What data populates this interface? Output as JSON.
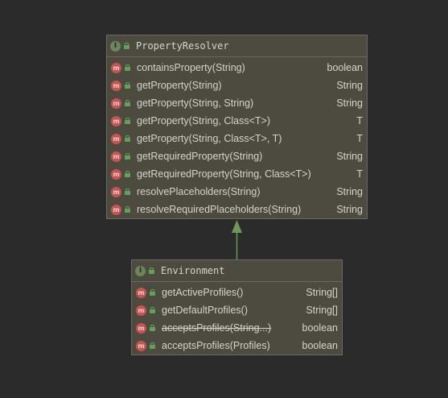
{
  "property_resolver": {
    "title": "PropertyResolver",
    "kind_icon": "interface-icon",
    "kind_letter": "I",
    "methods": [
      {
        "name": "containsProperty(String)",
        "type": "boolean",
        "deprecated": false
      },
      {
        "name": "getProperty(String)",
        "type": "String",
        "deprecated": false
      },
      {
        "name": "getProperty(String, String)",
        "type": "String",
        "deprecated": false
      },
      {
        "name": "getProperty(String, Class<T>)",
        "type": "T",
        "deprecated": false
      },
      {
        "name": "getProperty(String, Class<T>, T)",
        "type": "T",
        "deprecated": false
      },
      {
        "name": "getRequiredProperty(String)",
        "type": "String",
        "deprecated": false
      },
      {
        "name": "getRequiredProperty(String, Class<T>)",
        "type": "T",
        "deprecated": false
      },
      {
        "name": "resolvePlaceholders(String)",
        "type": "String",
        "deprecated": false
      },
      {
        "name": "resolveRequiredPlaceholders(String)",
        "type": "String",
        "deprecated": false
      }
    ]
  },
  "environment": {
    "title": "Environment",
    "kind_icon": "interface-icon",
    "kind_letter": "I",
    "methods": [
      {
        "name": "getActiveProfiles()",
        "type": "String[]",
        "deprecated": false
      },
      {
        "name": "getDefaultProfiles()",
        "type": "String[]",
        "deprecated": false
      },
      {
        "name": "acceptsProfiles(String...)",
        "type": "boolean",
        "deprecated": true
      },
      {
        "name": "acceptsProfiles(Profiles)",
        "type": "boolean",
        "deprecated": false
      }
    ]
  },
  "method_icon_letter": "m",
  "colors": {
    "background": "#2b2b2b",
    "box": "#4d4b3f",
    "border": "#6b6a60",
    "inheritance_arrow": "#6a9955",
    "method_icon": "#c75450",
    "interface_icon": "#6a8759"
  }
}
